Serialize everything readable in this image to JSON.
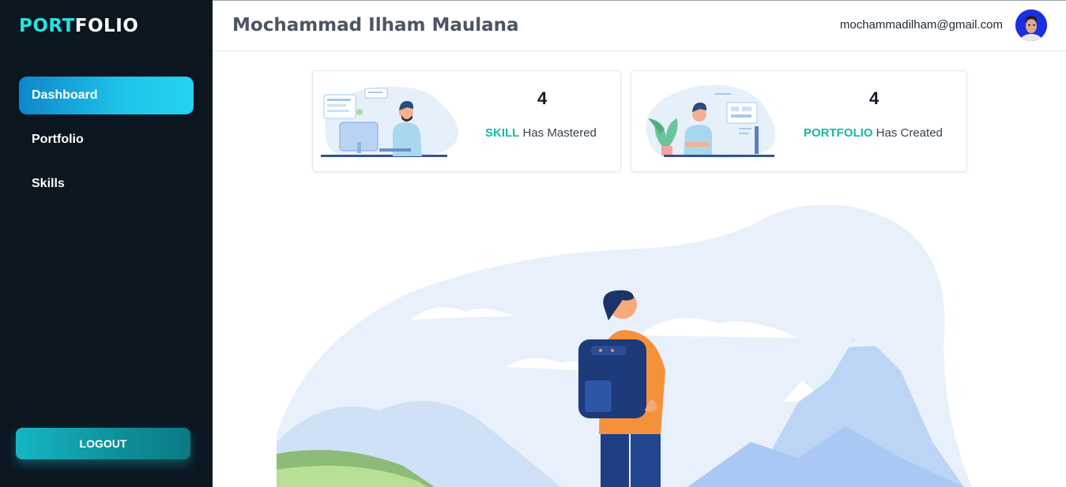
{
  "sidebar": {
    "logo": {
      "part1": "PORT",
      "part2": "FOLIO"
    },
    "items": [
      {
        "label": "Dashboard",
        "active": true
      },
      {
        "label": "Portfolio",
        "active": false
      },
      {
        "label": "Skills",
        "active": false
      }
    ],
    "logout_label": "LOGOUT"
  },
  "header": {
    "title": "Mochammad Ilham Maulana",
    "email": "mochammadilham@gmail.com"
  },
  "cards": [
    {
      "count": "4",
      "highlight": "SKILL",
      "text": " Has Mastered"
    },
    {
      "count": "4",
      "highlight": "PORTFOLIO",
      "text": " Has Created"
    }
  ],
  "colors": {
    "sidebar_bg": "#0b1620",
    "accent": "#22e5e0",
    "highlight": "#14b8a6",
    "active_nav": "#1fc4ea"
  }
}
